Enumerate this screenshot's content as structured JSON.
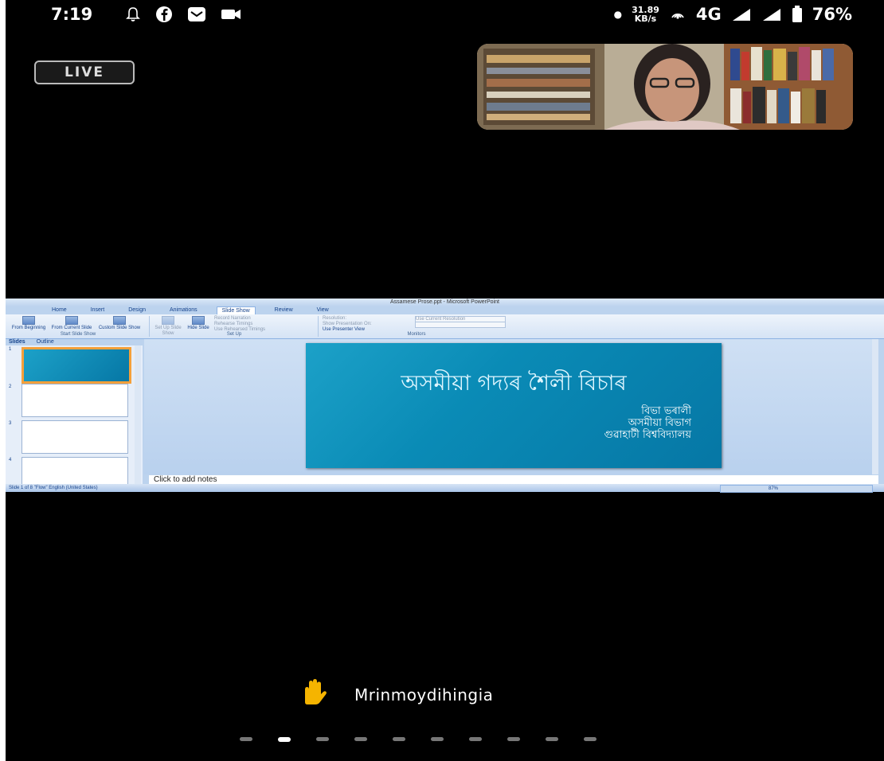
{
  "status_bar": {
    "time": "7:19",
    "net_speed_value": "31.89",
    "net_speed_unit": "KB/s",
    "network": "4G",
    "battery": "76%"
  },
  "live_badge": "LIVE",
  "powerpoint": {
    "window_title": "Assamese Prose.ppt - Microsoft PowerPoint",
    "tabs": [
      "Home",
      "Insert",
      "Design",
      "Animations",
      "Slide Show",
      "Review",
      "View"
    ],
    "active_tab": "Slide Show",
    "ribbon": {
      "from_beginning": "From Beginning",
      "from_current": "From Current Slide",
      "custom_show": "Custom Slide Show",
      "group_start": "Start Slide Show",
      "setup_show": "Set Up Slide Show",
      "hide_slide": "Hide Slide",
      "record_narration": "Record Narration",
      "rehearse_timings": "Rehearse Timings",
      "use_rehearsed": "Use Rehearsed Timings",
      "group_setup": "Set Up",
      "resolution": "Resolution:",
      "resolution_value": "Use Current Resolution",
      "show_on": "Show Presentation On:",
      "presenter_view": "Use Presenter View",
      "group_monitors": "Monitors"
    },
    "panel_tabs": [
      "Slides",
      "Outline"
    ],
    "slide_numbers": [
      "1",
      "2",
      "3",
      "4"
    ],
    "slide": {
      "title": "অসমীয়া গদ্যৰ শৈলী বিচাৰ",
      "subtitle_lines": [
        "বিভা ভৰালী",
        "অসমীয়া বিভাগ",
        "গুৱাহাটী বিশ্ববিদ্যালয়"
      ]
    },
    "notes_placeholder": "Click to add notes",
    "status_left": "Slide 1 of 8    \"Flow\"    English (United States)",
    "zoom": "87%"
  },
  "participant": {
    "name": "Mrinmoydihingia",
    "reaction_icon": "raised-hand-icon"
  },
  "pager": {
    "page_count": 10,
    "active_index": 1
  },
  "colors": {
    "background": "#000000",
    "slide_blue": "#0a8bb6",
    "hand": "#f5b400"
  }
}
